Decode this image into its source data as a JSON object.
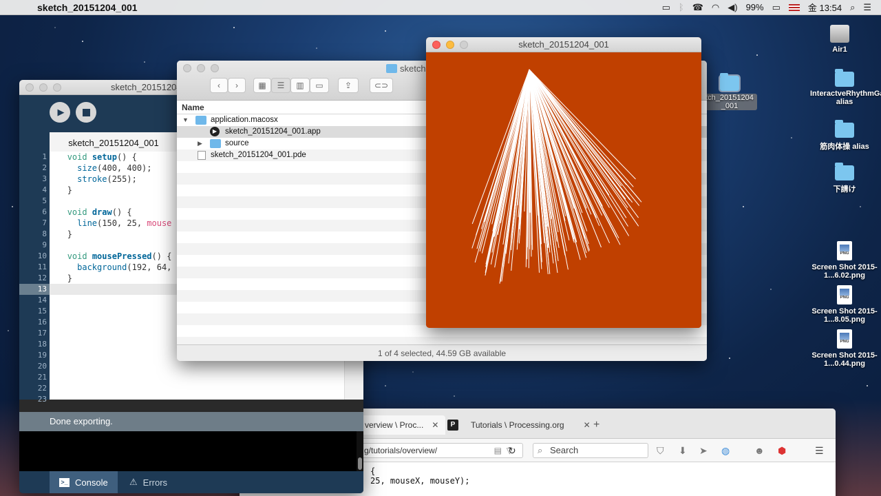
{
  "menubar": {
    "app_title": "sketch_20151204_001",
    "battery": "99%",
    "clock": "金 13:54",
    "icons": [
      "apple-icon",
      "screen-mirroring-icon",
      "bluetooth-icon",
      "phone-icon",
      "wifi-icon",
      "volume-icon",
      "battery-icon",
      "flag-icon",
      "spotlight-icon",
      "menu-list-icon"
    ]
  },
  "ide": {
    "title": "sketch_20151204_001",
    "tab": "sketch_20151204_001",
    "current_line": 13,
    "line_numbers": [
      "1",
      "2",
      "3",
      "4",
      "5",
      "6",
      "7",
      "8",
      "9",
      "10",
      "11",
      "12",
      "13",
      "14",
      "15",
      "16",
      "17",
      "18",
      "19",
      "20",
      "21",
      "22",
      "23"
    ],
    "status": "Done exporting.",
    "console_tab": "Console",
    "errors_tab": "Errors"
  },
  "code_lines": {
    "l1_kw": "void",
    "l1_fn": "setup",
    "l1_rest": "() {",
    "l2_fn": "size",
    "l2_rest": "(400, 400);",
    "l3_fn": "stroke",
    "l3_rest": "(255);",
    "l4": "}",
    "l6_kw": "void",
    "l6_fn": "draw",
    "l6_rest": "() {",
    "l7_fn": "line",
    "l7_rest": "(150, 25, ",
    "l7_mouse": "mouse",
    "l8": "}",
    "l10_kw": "void",
    "l10_fn": "mousePressed",
    "l10_rest": "() {",
    "l11_fn": "background",
    "l11_rest": "(192, 64,",
    "l12": "}"
  },
  "finder": {
    "title": "sketch",
    "column_header": "Name",
    "rows": [
      {
        "name": "application.macosx",
        "type": "folder",
        "expanded": true
      },
      {
        "name": "sketch_20151204_001.app",
        "type": "app",
        "selected": true
      },
      {
        "name": "source",
        "type": "folder",
        "expanded": false
      },
      {
        "name": "sketch_20151204_001.pde",
        "type": "file"
      }
    ],
    "status": "1 of 4 selected, 44.59 GB available"
  },
  "sketch_window": {
    "title": "sketch_20151204_001",
    "background_color": "#c04000",
    "stroke_color": "#ffffff"
  },
  "browser": {
    "tab1": "verview \\ Proc...",
    "tab2": "Tutorials \\ Processing.org",
    "url": "g/tutorials/overview/",
    "search_placeholder": "Search",
    "content_line1": "{",
    "content_line2": "25, mouseX, mouseY);"
  },
  "desktop_icons": [
    {
      "label": "Air1",
      "kind": "drive"
    },
    {
      "label": "InteractveRhythmGame alias",
      "kind": "folder"
    },
    {
      "label": "筋肉体操 alias",
      "kind": "folder"
    },
    {
      "label": "下請け",
      "kind": "folder"
    },
    {
      "label": "Screen Shot 2015-1...6.02.png",
      "kind": "png"
    },
    {
      "label": "Screen Shot 2015-1...8.05.png",
      "kind": "png"
    },
    {
      "label": "Screen Shot 2015-1...0.44.png",
      "kind": "png"
    }
  ],
  "desktop_folder": {
    "label": "tch_20151204 _001"
  }
}
